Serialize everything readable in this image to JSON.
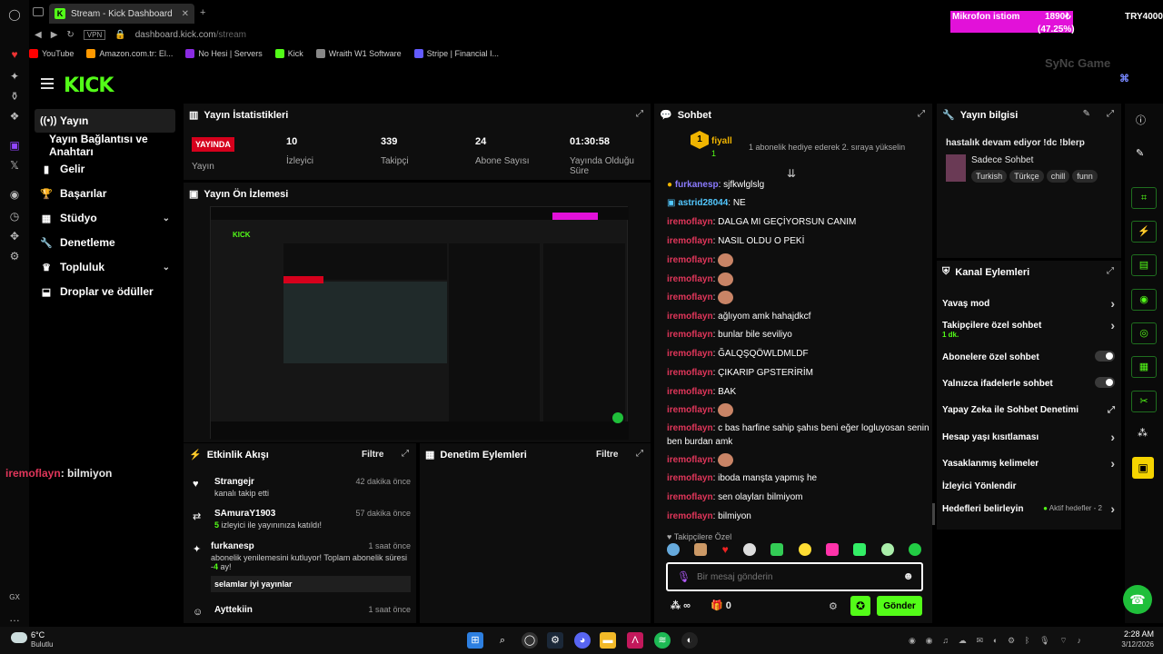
{
  "browser": {
    "tab_title": "Stream - Kick Dashboard",
    "url_host": "dashboard.kick.com",
    "url_path": "/stream",
    "vpn": "VPN",
    "bookmarks": [
      "YouTube",
      "Amazon.com.tr: El...",
      "No Hesi | Servers",
      "Kick",
      "Wraith W1 Software",
      "Stripe | Financial I..."
    ],
    "bookmark_colors": [
      "#ff0000",
      "#ff9900",
      "#8a2be2",
      "#53fc18",
      "#888888",
      "#635bff"
    ]
  },
  "overlay": {
    "mic_label": "Mikrofon istiom",
    "mic_value": "1890₺",
    "mic_percent": "(47.25%)",
    "try": "TRY4000",
    "brand": "SyNc Game",
    "chat_overlay_user": "iremoflayn",
    "chat_overlay_msg": ": bilmiyon",
    "gx": "GX"
  },
  "nav": {
    "items": [
      {
        "label": "Yayın",
        "icon": "((•))"
      },
      {
        "label": "Yayın Bağlantısı ve Anahtarı",
        "icon": ""
      },
      {
        "label": "Gelir",
        "icon": "▮"
      },
      {
        "label": "Başarılar",
        "icon": "🏆"
      },
      {
        "label": "Stüdyo",
        "icon": "▦"
      },
      {
        "label": "Denetleme",
        "icon": "🔧"
      },
      {
        "label": "Topluluk",
        "icon": "♛"
      },
      {
        "label": "Droplar ve ödüller",
        "icon": "⬓"
      }
    ]
  },
  "stats": {
    "title": "Yayın İstatistikleri",
    "live": "YAYINDA",
    "live_label": "Yayın",
    "items": [
      {
        "value": "10",
        "label": "İzleyici"
      },
      {
        "value": "339",
        "label": "Takipçi"
      },
      {
        "value": "24",
        "label": "Abone Sayısı"
      },
      {
        "value": "01:30:58",
        "label": "Yayında Olduğu Süre"
      }
    ]
  },
  "preview": {
    "title": "Yayın Ön İzlemesi"
  },
  "activity": {
    "title": "Etkinlik Akışı",
    "filter": "Filtre",
    "events": [
      {
        "name": "Strangejr",
        "desc": "kanalı takip etti",
        "time": "42 dakika önce",
        "icon": "♥"
      },
      {
        "name": "SAmuraY1903",
        "desc_count": "5",
        "desc": " izleyici ile yayınınıza katıldı!",
        "time": "57 dakika önce",
        "icon": "⇄"
      },
      {
        "name": "furkanesp",
        "desc": "abonelik yenilemesini kutluyor! Toplam abonelik süresi -",
        "desc_count": "4",
        "desc2": " ay!",
        "msg": "selamlar iyi yayınlar",
        "time": "1 saat önce",
        "icon": "✦"
      },
      {
        "name": "Ayttekiin",
        "desc": "",
        "time": "1 saat önce",
        "icon": "☺"
      }
    ]
  },
  "moderation": {
    "title": "Denetim Eylemleri",
    "filter": "Filtre"
  },
  "chat": {
    "title": "Sohbet",
    "pinned_user": "fiyall",
    "pinned_count": "1",
    "pinned_msg": "1 abonelik hediye ederek 2. sıraya yükselin",
    "messages": [
      {
        "user": "furkanesp",
        "text": ": sjfkwlglslg",
        "style": "u2"
      },
      {
        "user": "astrid28044",
        "text": ": NE",
        "style": "u3"
      },
      {
        "user": "iremoflayn",
        "text": ": DALGA MI GEÇİYORSUN CANIM",
        "style": "u"
      },
      {
        "user": "iremoflayn",
        "text": ": NASIL OLDU O PEKİ",
        "style": "u"
      },
      {
        "user": "iremoflayn",
        "text": ":",
        "style": "u",
        "emote": true
      },
      {
        "user": "iremoflayn",
        "text": ":",
        "style": "u",
        "emote": true
      },
      {
        "user": "iremoflayn",
        "text": ":",
        "style": "u",
        "emote": true
      },
      {
        "user": "iremoflayn",
        "text": ": ağlıyom amk hahajdkcf",
        "style": "u"
      },
      {
        "user": "iremoflayn",
        "text": ": bunlar bile seviliyo",
        "style": "u"
      },
      {
        "user": "iremoflayn",
        "text": ": ĞALQŞQÖWLDMLDF",
        "style": "u"
      },
      {
        "user": "iremoflayn",
        "text": ": ÇIKARIP GPSTERİRİM",
        "style": "u"
      },
      {
        "user": "iremoflayn",
        "text": ": BAK",
        "style": "u"
      },
      {
        "user": "iremoflayn",
        "text": ":",
        "style": "u",
        "emote": true
      },
      {
        "user": "iremoflayn",
        "text": ": c bas harfine sahip şahıs beni eğer logluyosan senin ben burdan amk",
        "style": "u"
      },
      {
        "user": "iremoflayn",
        "text": ":",
        "style": "u",
        "emote": true
      },
      {
        "user": "iremoflayn",
        "text": ": iboda manşta yapmış he",
        "style": "u"
      },
      {
        "user": "iremoflayn",
        "text": ": sen olayları bilmiyom",
        "style": "u"
      },
      {
        "user": "iremoflayn",
        "text": ": bilmiyon",
        "style": "u"
      }
    ],
    "followers_only": "Takipçilere Özel",
    "placeholder": "Bir mesaj gönderin",
    "points": "∞",
    "gift_count": "0",
    "send": "Gönder"
  },
  "info": {
    "title": "Yayın bilgisi",
    "stream_title": "hastalık devam ediyor !dc !blerp",
    "category": "Sadece Sohbet",
    "tags": [
      "Turkish",
      "Türkçe",
      "chill",
      "funn"
    ]
  },
  "channel": {
    "title": "Kanal Eylemleri",
    "rows": [
      {
        "label": "Yavaş mod",
        "type": "chev"
      },
      {
        "label": "Takipçilere özel sohbet",
        "sub": "1 dk.",
        "type": "chev"
      },
      {
        "label": "Abonelere özel sohbet",
        "type": "toggle"
      },
      {
        "label": "Yalnızca ifadelerle sohbet",
        "type": "toggle"
      },
      {
        "label": "Yapay Zeka ile Sohbet Denetimi",
        "type": "ext"
      },
      {
        "label": "Hesap yaşı kısıtlaması",
        "type": "chev"
      },
      {
        "label": "Yasaklanmış kelimeler",
        "type": "chev"
      },
      {
        "label": "İzleyici Yönlendir",
        "type": "none"
      },
      {
        "label": "Hedefleri belirleyin",
        "extra": "Aktif hedefler - 2",
        "type": "chev"
      }
    ]
  },
  "taskbar": {
    "weather_temp": "6°C",
    "weather_desc": "Bulutlu",
    "time": "2:28 AM",
    "date": "3/12/2026"
  }
}
